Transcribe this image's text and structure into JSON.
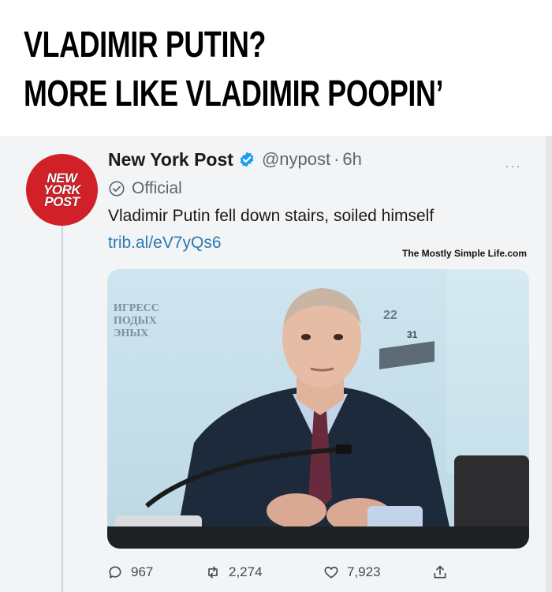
{
  "caption": {
    "line1": "VLADIMIR PUTIN?",
    "line2": "MORE LIKE VLADIMIR POOPIN’"
  },
  "tweet": {
    "avatar_text": "NEW\nYORK\nPOST",
    "display_name": "New York Post",
    "handle": "@nypost",
    "separator": "·",
    "time": "6h",
    "more": "···",
    "official_label": "Official",
    "text": "Vladimir Putin fell down stairs, soiled himself",
    "link": "trib.al/eV7yQs6",
    "watermark": "The Mostly Simple Life.com",
    "photo_bg_text": "ИГРЕСС\nПОДЫХ\nЭНЫХ",
    "photo_bg_number": "22",
    "photo_bg_number2": "31",
    "actions": {
      "replies": "967",
      "retweets": "2,274",
      "likes": "7,923"
    }
  },
  "colors": {
    "brand_red": "#d12027",
    "verified_blue": "#1d9bf0",
    "link_blue": "#2a7ab0",
    "muted_text": "#5b6670"
  },
  "icons": {
    "verified": "verified-badge-icon",
    "official": "check-circle-icon",
    "reply": "reply-icon",
    "retweet": "retweet-icon",
    "like": "heart-icon",
    "share": "share-icon",
    "more": "more-icon"
  }
}
